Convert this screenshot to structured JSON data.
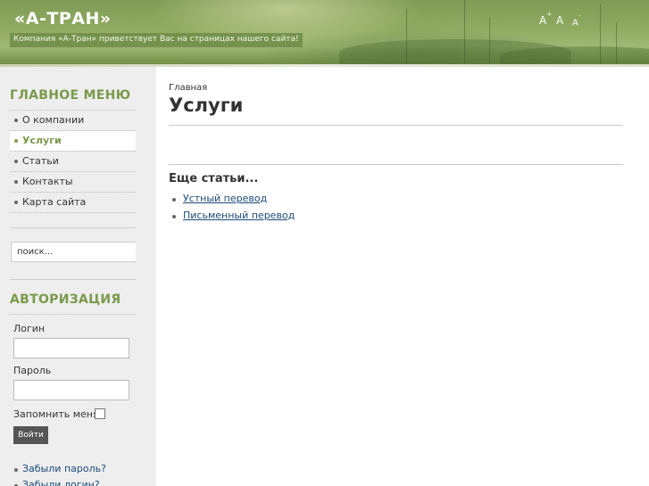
{
  "header": {
    "site_title": "«А-ТРАН»",
    "slogan": "Компания «А-Тран» приветствует Вас на страницах нашего сайта!",
    "font_tools": {
      "increase": "A",
      "increase_sup": "+",
      "reset": "A",
      "decrease": "A",
      "decrease_sup": "-"
    }
  },
  "main_menu": {
    "title": "ГЛАВНОЕ МЕНЮ",
    "items": [
      {
        "label": "О компании",
        "active": false
      },
      {
        "label": "Услуги",
        "active": true
      },
      {
        "label": "Статьи",
        "active": false
      },
      {
        "label": "Контакты",
        "active": false
      },
      {
        "label": "Карта сайта",
        "active": false
      }
    ]
  },
  "search": {
    "value": "поиск..."
  },
  "login": {
    "title": "АВТОРИЗАЦИЯ",
    "username_label": "Логин",
    "password_label": "Пароль",
    "remember_label": "Запомнить меня",
    "submit_label": "Войти",
    "links": [
      "Забыли пароль?",
      "Забыли логин?"
    ]
  },
  "main": {
    "breadcrumb": "Главная",
    "page_title": "Услуги",
    "more_heading": "Еще статьи...",
    "articles": [
      "Устный перевод",
      "Письменный перевод"
    ]
  },
  "colors": {
    "accent": "#7a9a4c",
    "link": "#1b4a78",
    "sidebar_bg": "#eeeeee"
  }
}
